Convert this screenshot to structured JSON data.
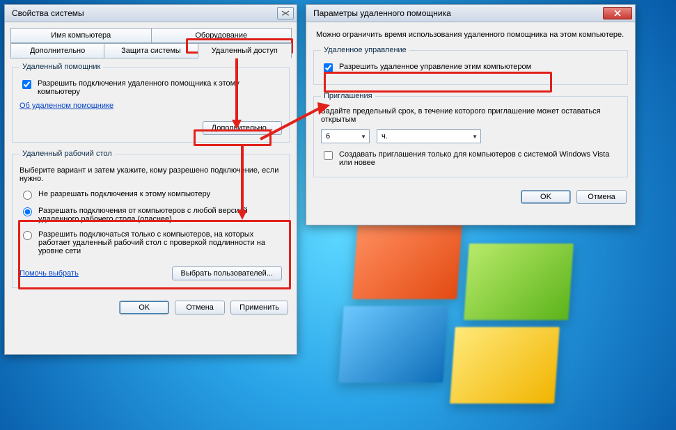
{
  "win1": {
    "title": "Свойства системы",
    "tabs_row1": [
      "Имя компьютера",
      "Оборудование"
    ],
    "tabs_row2": [
      "Дополнительно",
      "Защита системы",
      "Удаленный доступ"
    ],
    "fs1_legend": "Удаленный помощник",
    "chk_allow_ra": "Разрешить подключения удаленного помощника к этому компьютеру",
    "link_about": "Об удаленном помощнике",
    "btn_advanced": "Дополнительно...",
    "fs2_legend": "Удаленный рабочий стол",
    "fs2_text": "Выберите вариант и затем укажите, кому разрешено подключение, если нужно.",
    "rd1": "Не разрешать подключения к этому компьютеру",
    "rd2": "Разрешать подключения от компьютеров с любой версией удаленного рабочего стола (опаснее)",
    "rd3": "Разрешить подключаться только с компьютеров, на которых работает удаленный рабочий стол с проверкой подлинности на уровне сети",
    "link_help": "Помочь выбрать",
    "btn_selusers": "Выбрать пользователей...",
    "btn_ok": "OK",
    "btn_cancel": "Отмена",
    "btn_apply": "Применить"
  },
  "win2": {
    "title": "Параметры удаленного помощника",
    "intro": "Можно ограничить время использования удаленного помощника на этом компьютере.",
    "fs1_legend": "Удаленное управление",
    "chk_allow_ctrl": "Разрешить удаленное управление этим компьютером",
    "fs2_legend": "Приглашения",
    "fs2_text": "Задайте предельный срок, в течение которого приглашение может оставаться открытым",
    "sel_num": "6",
    "sel_unit": "ч.",
    "chk_vista": "Создавать приглашения только для компьютеров с системой Windows Vista или новее",
    "btn_ok": "OK",
    "btn_cancel": "Отмена"
  }
}
